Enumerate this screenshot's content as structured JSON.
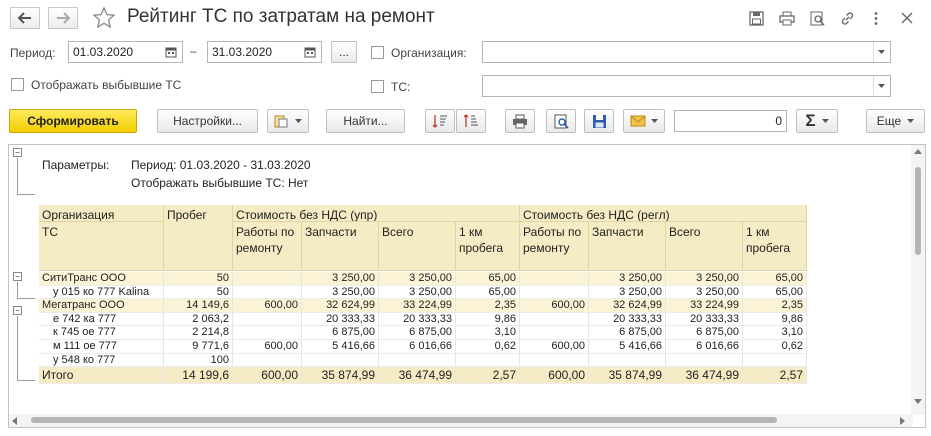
{
  "window": {
    "title": "Рейтинг ТС по затратам на ремонт"
  },
  "filters": {
    "period_label": "Период:",
    "date_from": "01.03.2020",
    "date_sep": "–",
    "date_to": "31.03.2020",
    "dots_label": "...",
    "org_label": "Организация:",
    "org_value": "",
    "ts_label": "ТС:",
    "ts_value": "",
    "show_retired_label": "Отображать выбывшие ТС"
  },
  "toolbar": {
    "generate_label": "Сформировать",
    "settings_label": "Настройки...",
    "find_label": "Найти...",
    "sum_value": "0",
    "more_label": "Еще"
  },
  "report": {
    "params_label": "Параметры:",
    "param_period": "Период: 01.03.2020 - 31.03.2020",
    "param_retired": "Отображать выбывшие ТС: Нет",
    "headers": {
      "org": "Организация",
      "ts": "ТС",
      "mileage": "Пробег",
      "cost_upr": "Стоимость без НДС (упр)",
      "cost_regl": "Стоимость без НДС (регл)",
      "repair_works": "Работы по ремонту",
      "parts": "Запчасти",
      "total": "Всего",
      "per_km": "1 км пробега"
    },
    "rows": [
      {
        "name": "СитиТранс ООО",
        "level": 0,
        "mileage": "50",
        "w1": "",
        "p1": "3 250,00",
        "t1": "3 250,00",
        "k1": "65,00",
        "w2": "",
        "p2": "3 250,00",
        "t2": "3 250,00",
        "k2": "65,00"
      },
      {
        "name": "у 015 ко 777 Kalina",
        "level": 1,
        "mileage": "50",
        "w1": "",
        "p1": "3 250,00",
        "t1": "3 250,00",
        "k1": "65,00",
        "w2": "",
        "p2": "3 250,00",
        "t2": "3 250,00",
        "k2": "65,00"
      },
      {
        "name": "Мегатранс ООО",
        "level": 0,
        "mileage": "14 149,6",
        "w1": "600,00",
        "p1": "32 624,99",
        "t1": "33 224,99",
        "k1": "2,35",
        "w2": "600,00",
        "p2": "32 624,99",
        "t2": "33 224,99",
        "k2": "2,35"
      },
      {
        "name": "е 742 ка 777",
        "level": 1,
        "mileage": "2 063,2",
        "w1": "",
        "p1": "20 333,33",
        "t1": "20 333,33",
        "k1": "9,86",
        "w2": "",
        "p2": "20 333,33",
        "t2": "20 333,33",
        "k2": "9,86"
      },
      {
        "name": "к 745 ое 777",
        "level": 1,
        "mileage": "2 214,8",
        "w1": "",
        "p1": "6 875,00",
        "t1": "6 875,00",
        "k1": "3,10",
        "w2": "",
        "p2": "6 875,00",
        "t2": "6 875,00",
        "k2": "3,10"
      },
      {
        "name": "м 111 ое 777",
        "level": 1,
        "mileage": "9 771,6",
        "w1": "600,00",
        "p1": "5 416,66",
        "t1": "6 016,66",
        "k1": "0,62",
        "w2": "600,00",
        "p2": "5 416,66",
        "t2": "6 016,66",
        "k2": "0,62"
      },
      {
        "name": "у 548 ко 777",
        "level": 1,
        "mileage": "100",
        "w1": "",
        "p1": "",
        "t1": "",
        "k1": "",
        "w2": "",
        "p2": "",
        "t2": "",
        "k2": ""
      }
    ],
    "total": {
      "name": "Итого",
      "mileage": "14 199,6",
      "w1": "600,00",
      "p1": "35 874,99",
      "t1": "36 474,99",
      "k1": "2,57",
      "w2": "600,00",
      "p2": "35 874,99",
      "t2": "36 474,99",
      "k2": "2,57"
    }
  },
  "icons": [
    "back-arrow-icon",
    "forward-arrow-icon",
    "star-icon",
    "save-icon",
    "print-icon",
    "preview-icon",
    "link-icon",
    "more-vert-icon",
    "close-icon",
    "calendar-icon",
    "sort-asc-icon",
    "sort-desc-icon",
    "mail-icon",
    "sum-icon"
  ]
}
